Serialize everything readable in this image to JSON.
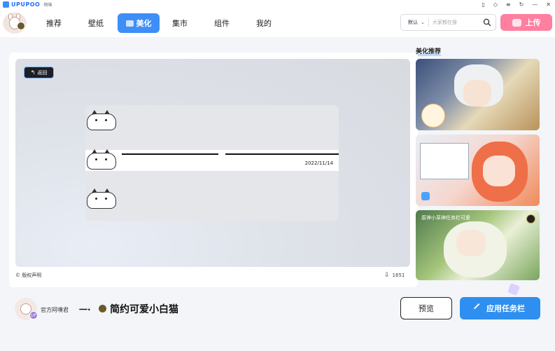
{
  "app": {
    "logo_text": "UPUPOO",
    "logo_sub": "啊噗"
  },
  "window_controls": [
    "▯",
    "◇",
    "≡",
    "↻",
    "—",
    "✕"
  ],
  "nav": {
    "tabs": [
      {
        "label": "推荐",
        "active": false
      },
      {
        "label": "壁纸",
        "active": false
      },
      {
        "label": "美化",
        "active": true
      },
      {
        "label": "集市",
        "active": false
      },
      {
        "label": "组件",
        "active": false
      },
      {
        "label": "我的",
        "active": false
      }
    ],
    "search": {
      "scope": "默认",
      "placeholder": "大家都在搜",
      "icon": "search-icon"
    },
    "upload_label": "上传"
  },
  "preview": {
    "back_label": "返回",
    "task_date": "2022/11/14",
    "copyright": "© 版权声明",
    "downloads": "1651"
  },
  "detail": {
    "author": "官方阿噗君",
    "author_badge": "UP",
    "title_prefix": "一·",
    "title": "简约可爱小白猫",
    "preview_label": "预览",
    "apply_label": "应用任务栏"
  },
  "sidebar": {
    "title": "美化推荐",
    "cards": [
      {
        "text": ""
      },
      {
        "text": ""
      },
      {
        "text": "原神小草神任务栏可爱"
      }
    ]
  },
  "colors": {
    "accent": "#3d8ef7",
    "upload": "#ff7fa0",
    "apply": "#2f8ff0"
  }
}
